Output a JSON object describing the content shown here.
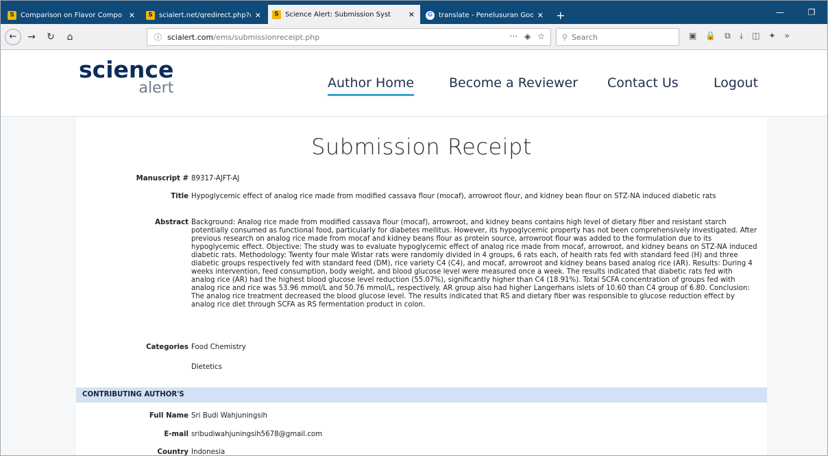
{
  "browser": {
    "tabs": [
      {
        "label": "Comparison on Flavor Compo",
        "icon": "s",
        "active": false
      },
      {
        "label": "scialert.net/qredirect.php?doi",
        "icon": "s",
        "active": false
      },
      {
        "label": "Science Alert: Submission Syst",
        "icon": "s",
        "active": true
      },
      {
        "label": "translate - Penelusuran Google",
        "icon": "g",
        "active": false
      }
    ],
    "newtab": "+",
    "url_host": "scialert.com",
    "url_path": "/ems/submissionreceipt.php",
    "search_placeholder": "Search",
    "more_dots": "···"
  },
  "site": {
    "logo_top": "science",
    "logo_bottom": "alert",
    "nav": [
      "Author Home",
      "Become a Reviewer",
      "Contact Us",
      "Logout"
    ]
  },
  "page": {
    "title": "Submission Receipt",
    "manuscript_label": "Manuscript #",
    "manuscript": "89317-AJFT-AJ",
    "title_label": "Title",
    "article_title": "Hypoglycemic effect of analog rice made from modified cassava flour (mocaf), arrowroot flour, and kidney bean flour on STZ-NA induced diabetic rats",
    "abstract_label": "Abstract",
    "abstract": "Background: Analog rice made from modified cassava flour (mocaf), arrowroot, and kidney beans contains high level of dietary fiber and resistant starch potentially consumed as functional food, particularly for diabetes mellitus. However, its hypoglycemic property has not been comprehensively investigated. After previous research on analog rice made from mocaf and kidney beans flour as protein source, arrowroot flour was added to the formulation due to its hypoglycemic effect. Objective: The study was to evaluate hypoglycemic effect of analog rice made from mocaf, arrowroot, and kidney beans on STZ-NA induced diabetic rats. Methodology: Twenty four male Wistar rats were randomly divided in 4 groups, 6 rats each, of health rats fed with standard feed (H) and three diabetic groups respectively fed with standard feed (DM), rice variety C4 (C4), and mocaf, arrowroot and kidney beans based analog rice (AR). Results: During 4 weeks intervention, feed consumption, body weight, and blood glucose level were measured once a week. The results indicated that diabetic rats fed with analog rice (AR) had the highest blood glucose level reduction (55.07%), significantly higher than C4 (18.91%). Total SCFA concentration of groups fed with analog rice and rice was 53.96 mmol/L and 50.76 mmol/L, respectively. AR group also had higher Langerhans islets of 10.60 than C4 group of 6.80. Conclusion: The analog rice treatment decreased the blood glucose level. The results indicated that RS and dietary fiber was responsible to glucose reduction effect by analog rice diet through SCFA as RS fermentation product in colon.",
    "categories_label": "Categories",
    "categories": [
      "Food Chemistry",
      "Dietetics"
    ],
    "section_authors": "CONTRIBUTING AUTHOR'S",
    "fullname_label": "Full Name",
    "fullname": "Sri Budi Wahjuningsih",
    "email_label": "E-mail",
    "email": "sribudiwahjuningsih5678@gmail.com",
    "country_label": "Country",
    "country": "Indonesia"
  },
  "colors": {
    "tabstrip": "#0f4a79",
    "accent_underline": "#36a3d5",
    "section_bg": "#d4e0f5",
    "logo": "#0d2c5a"
  }
}
